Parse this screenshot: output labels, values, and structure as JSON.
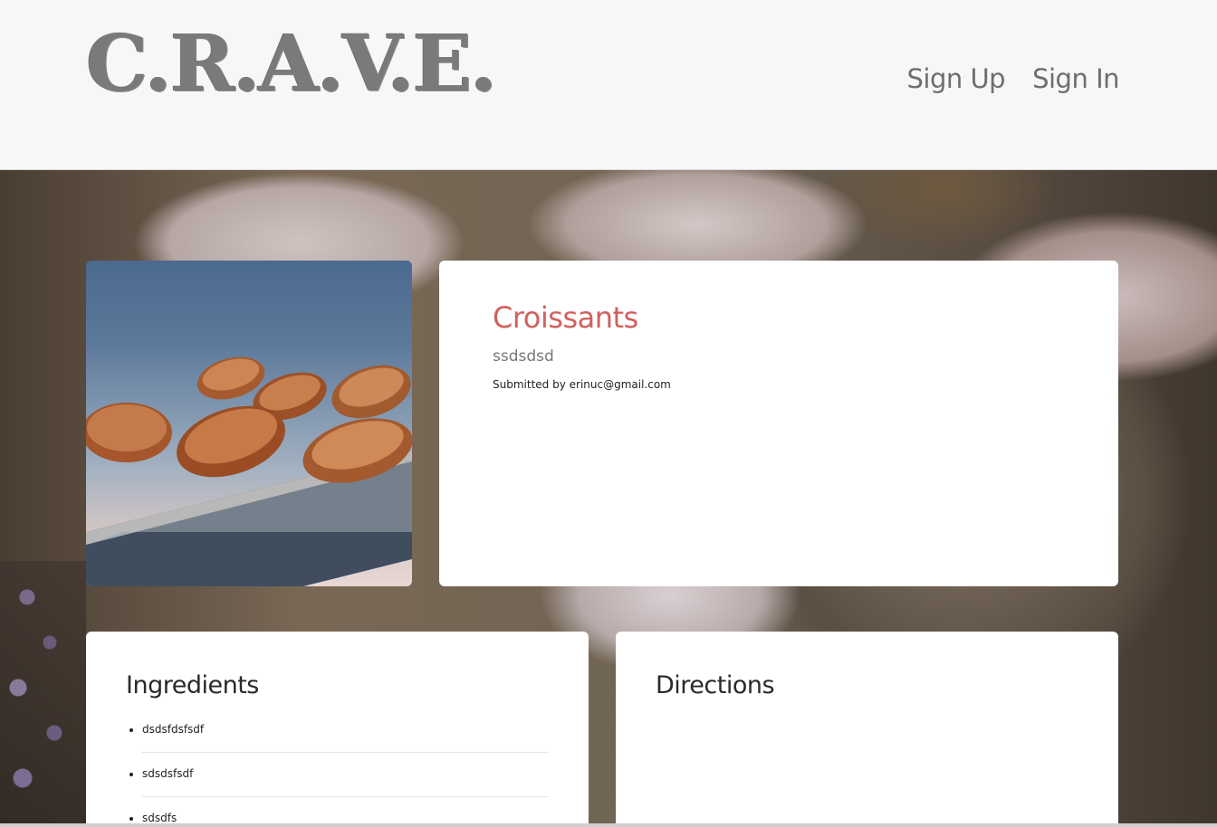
{
  "header": {
    "logo": "C.R.A.V.E.",
    "nav": {
      "sign_up": "Sign Up",
      "sign_in": "Sign In"
    }
  },
  "recipe": {
    "title": "Croissants",
    "description": "ssdsdsd",
    "submitted_by": "Submitted by erinuc@gmail.com"
  },
  "ingredients": {
    "heading": "Ingredients",
    "items": [
      "dsdsfdsfsdf",
      "sdsdsfsdf",
      "sdsdfs"
    ]
  },
  "directions": {
    "heading": "Directions"
  },
  "colors": {
    "accent": "#d0615d",
    "header_bg": "#f7f7f7",
    "logo": "#7a7a7a"
  }
}
